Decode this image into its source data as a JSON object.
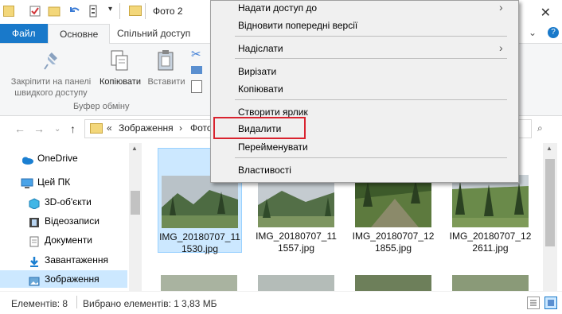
{
  "window": {
    "title": "Фото 2"
  },
  "ribbon": {
    "tabs": [
      "Файл",
      "Основне",
      "Спільний доступ"
    ],
    "pin_label_1": "Закріпити на панелі",
    "pin_label_2": "швидкого доступу",
    "copy_label": "Копіювати",
    "paste_label": "Вставити",
    "group_label": "Буфер обміну"
  },
  "address": {
    "chevron": "«",
    "crumb_1": "Зображення",
    "sep": "›",
    "crumb_2": "Фото"
  },
  "sidebar": {
    "items": [
      {
        "label": "OneDrive",
        "icon": "cloud-icon"
      },
      {
        "label": "Цей ПК",
        "icon": "computer-icon"
      },
      {
        "label": "3D-об'єкти",
        "icon": "cube-icon"
      },
      {
        "label": "Відеозаписи",
        "icon": "film-icon"
      },
      {
        "label": "Документи",
        "icon": "document-icon"
      },
      {
        "label": "Завантаження",
        "icon": "download-icon"
      },
      {
        "label": "Зображення",
        "icon": "pictures-icon"
      }
    ]
  },
  "files": [
    {
      "name_1": "IMG_20180707_11",
      "name_2": "1530.jpg"
    },
    {
      "name_1": "IMG_20180707_11",
      "name_2": "1557.jpg"
    },
    {
      "name_1": "IMG_20180707_12",
      "name_2": "1855.jpg"
    },
    {
      "name_1": "IMG_20180707_12",
      "name_2": "2611.jpg"
    }
  ],
  "status": {
    "count": "Елементів: 8",
    "selected": "Вибрано елементів: 1",
    "size": "3,83 МБ"
  },
  "context_menu": {
    "items": [
      "Надати доступ до",
      "Відновити попередні версії",
      "Надіслати",
      "Вирізати",
      "Копіювати",
      "Створити ярлик",
      "Видалити",
      "Перейменувати",
      "Властивості"
    ]
  },
  "colors": {
    "accent": "#1979ca",
    "highlight": "#d9232f",
    "selection": "#cce8ff"
  }
}
